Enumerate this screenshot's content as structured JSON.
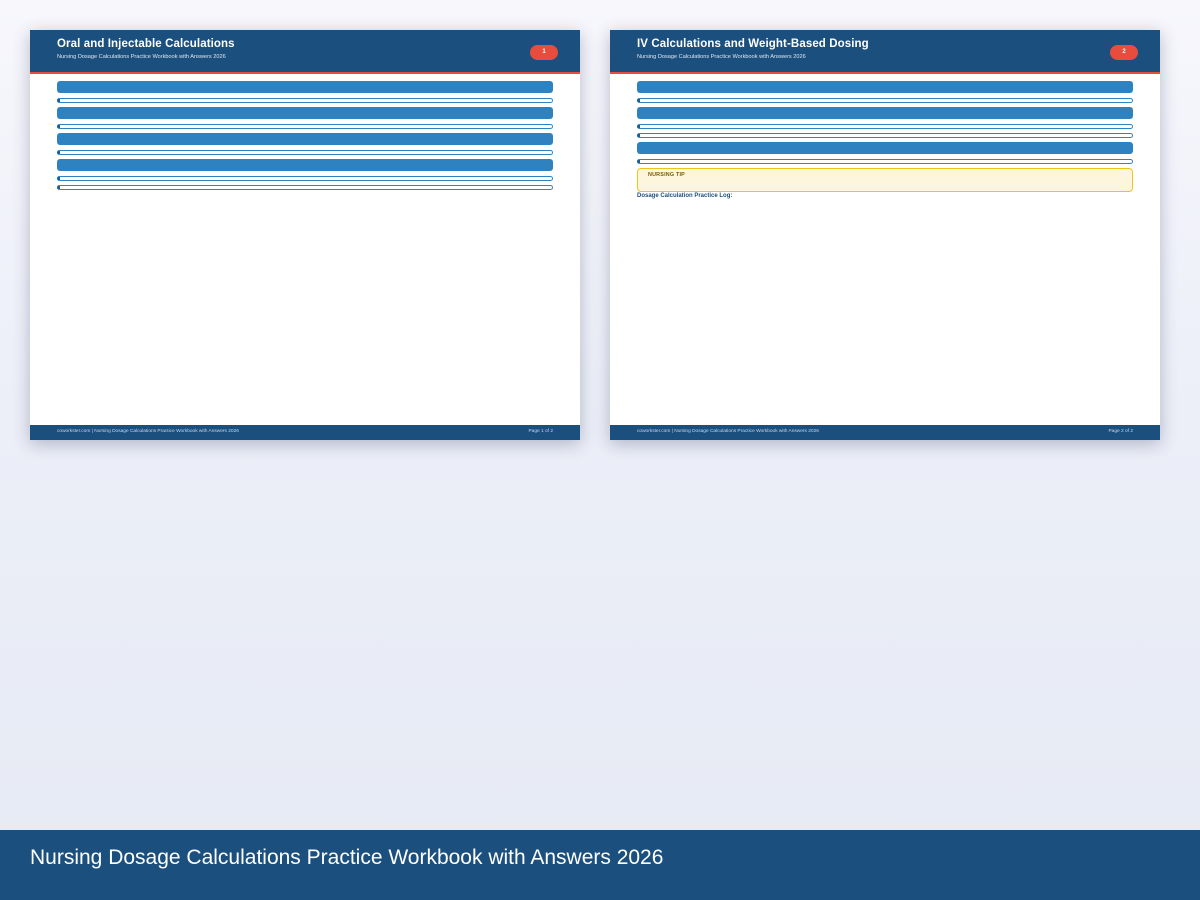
{
  "pages": [
    {
      "title": "Oral and Injectable Calculations",
      "subtitle": "Nursing Dosage Calculations Practice Workbook with Answers 2026",
      "badge": "1",
      "footer_text": "coworkster.com | Nursing Dosage Calculations Practice Workbook with Answers 2026",
      "footer_page": "Page 1 of 2"
    },
    {
      "title": "IV Calculations and Weight-Based Dosing",
      "subtitle": "Nursing Dosage Calculations Practice Workbook with Answers 2026",
      "badge": "2",
      "tip_label": "NURSING TIP",
      "log_heading": "Dosage Calculation Practice Log:",
      "footer_text": "coworkster.com | Nursing Dosage Calculations Practice Workbook with Answers 2026",
      "footer_page": "Page 2 of 2"
    }
  ],
  "banner": {
    "title": "Nursing Dosage Calculations Practice Workbook with Answers 2026"
  },
  "colors": {
    "header": "#1b4f7e",
    "accent_red": "#e74c3c",
    "bar_blue": "#2e82c0",
    "tip_fill": "#fdf6dc",
    "tip_border": "#f0c419"
  }
}
